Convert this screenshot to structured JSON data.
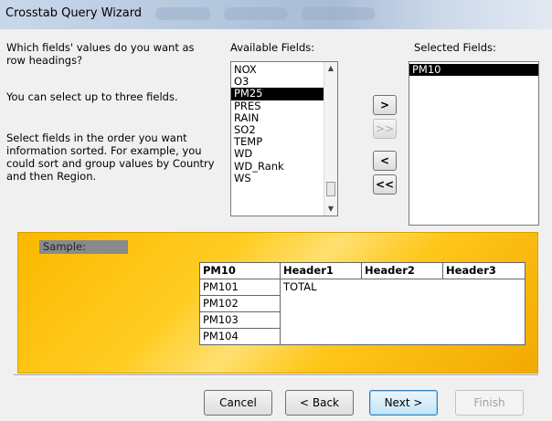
{
  "window": {
    "title": "Crosstab Query Wizard"
  },
  "instructions": {
    "line1": "Which fields' values do you want as",
    "line2": "row headings?",
    "line3": "You can select up to three fields.",
    "line4": "Select fields in the order you want",
    "line5": "information sorted.  For example, you",
    "line6": "could sort and group values by Country",
    "line7": "and then Region."
  },
  "available": {
    "label": "Available Fields:",
    "items": [
      "NOX",
      "O3",
      "PM25",
      "PRES",
      "RAIN",
      "SO2",
      "TEMP",
      "WD",
      "WD_Rank",
      "WS"
    ],
    "selected": "PM25"
  },
  "selected_fields": {
    "label": "Selected Fields:",
    "items": [
      "PM10"
    ]
  },
  "move_buttons": {
    "add": ">",
    "add_all": ">>",
    "remove": "<",
    "remove_all": "<<"
  },
  "sample": {
    "label": "Sample:",
    "headers": [
      "PM10",
      "Header1",
      "Header2",
      "Header3"
    ],
    "rows": [
      "PM101",
      "PM102",
      "PM103",
      "PM104"
    ],
    "total": "TOTAL"
  },
  "buttons": {
    "cancel": "Cancel",
    "back": "< Back",
    "next": "Next >",
    "finish": "Finish"
  }
}
